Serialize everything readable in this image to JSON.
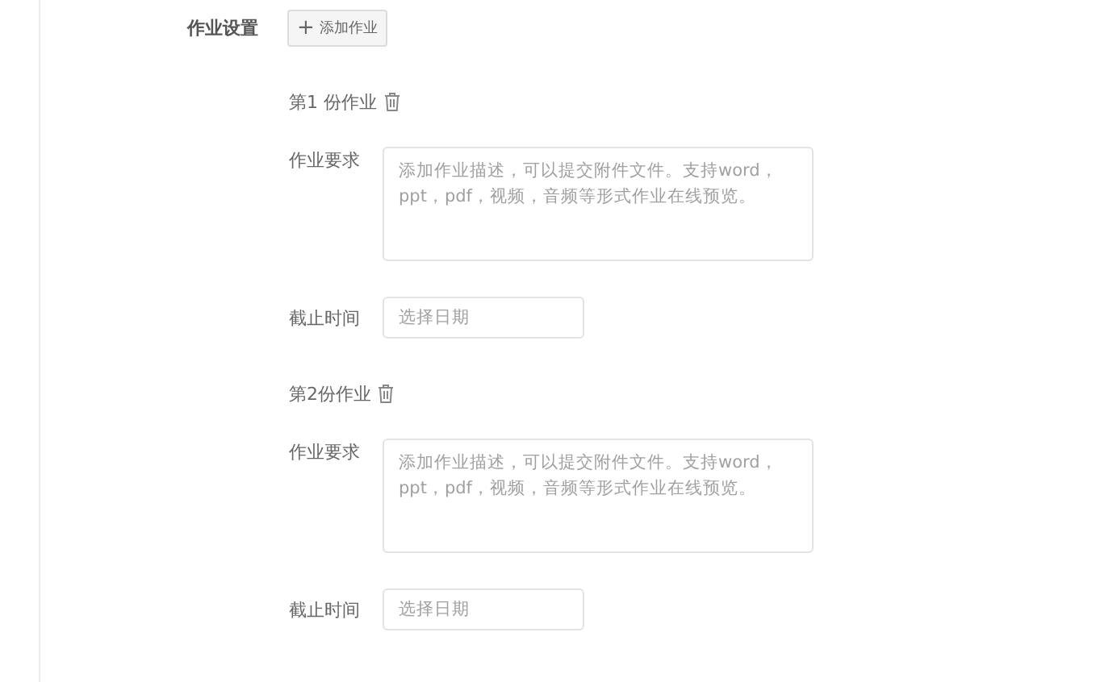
{
  "section_label": "作业设置",
  "add_button": {
    "icon": "+",
    "label": "添加作业"
  },
  "assignments": [
    {
      "title": "第1 份作业",
      "requirement": {
        "label": "作业要求",
        "placeholder": "添加作业描述，可以提交附件文件。支持word，ppt，pdf，视频，音频等形式作业在线预览。"
      },
      "deadline": {
        "label": "截止时间",
        "placeholder": "选择日期"
      }
    },
    {
      "title": "第2份作业",
      "requirement": {
        "label": "作业要求",
        "placeholder": "添加作业描述，可以提交附件文件。支持word，ppt，pdf，视频，音频等形式作业在线预览。"
      },
      "deadline": {
        "label": "截止时间",
        "placeholder": "选择日期"
      }
    }
  ]
}
